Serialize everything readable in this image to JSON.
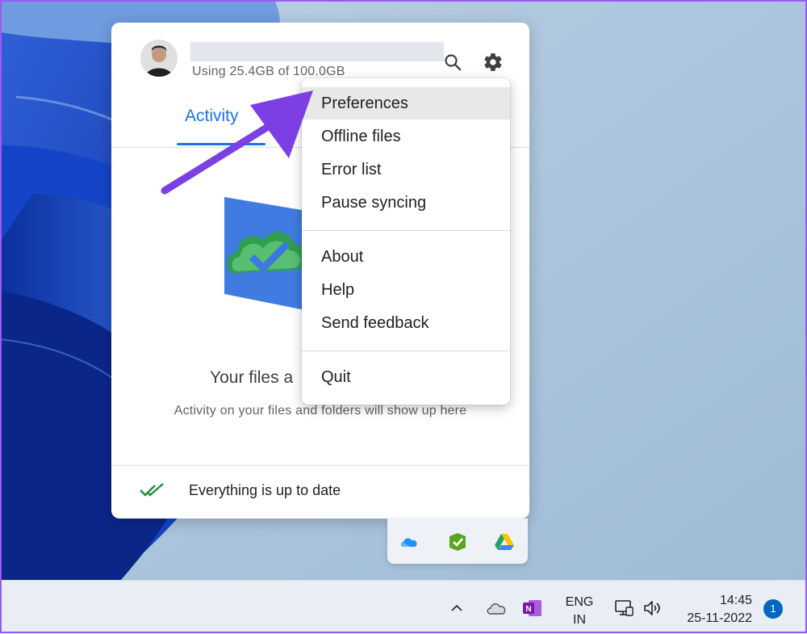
{
  "panel": {
    "quota_text": "Using 25.4GB of 100.0GB",
    "tab_activity": "Activity",
    "empty_title": "Your files a",
    "empty_description": "Activity on your files and folders will show up here",
    "footer_status": "Everything is up to date",
    "header_icons": [
      "search-icon",
      "gear-icon"
    ]
  },
  "menu": {
    "items": [
      {
        "label": "Preferences",
        "highlighted": true
      },
      {
        "label": "Offline files"
      },
      {
        "label": "Error list"
      },
      {
        "label": "Pause syncing"
      },
      {
        "label": "About"
      },
      {
        "label": "Help"
      },
      {
        "label": "Send feedback"
      },
      {
        "label": "Quit"
      }
    ]
  },
  "tray_flyout": {
    "icons": [
      "onedrive-icon",
      "green-check-app-icon",
      "google-drive-icon"
    ]
  },
  "taskbar": {
    "lang_line1": "ENG",
    "lang_line2": "IN",
    "time": "14:45",
    "date": "25-11-2022",
    "notification_count": "1",
    "icons": [
      "chevron-up-icon",
      "cloud-icon",
      "onenote-icon",
      "network-icon",
      "speaker-icon"
    ]
  },
  "colors": {
    "accent": "#1a73e8",
    "arrow": "#7b3fe4",
    "highlight": "#e8e8e8",
    "taskbar": "#e9eef5"
  }
}
